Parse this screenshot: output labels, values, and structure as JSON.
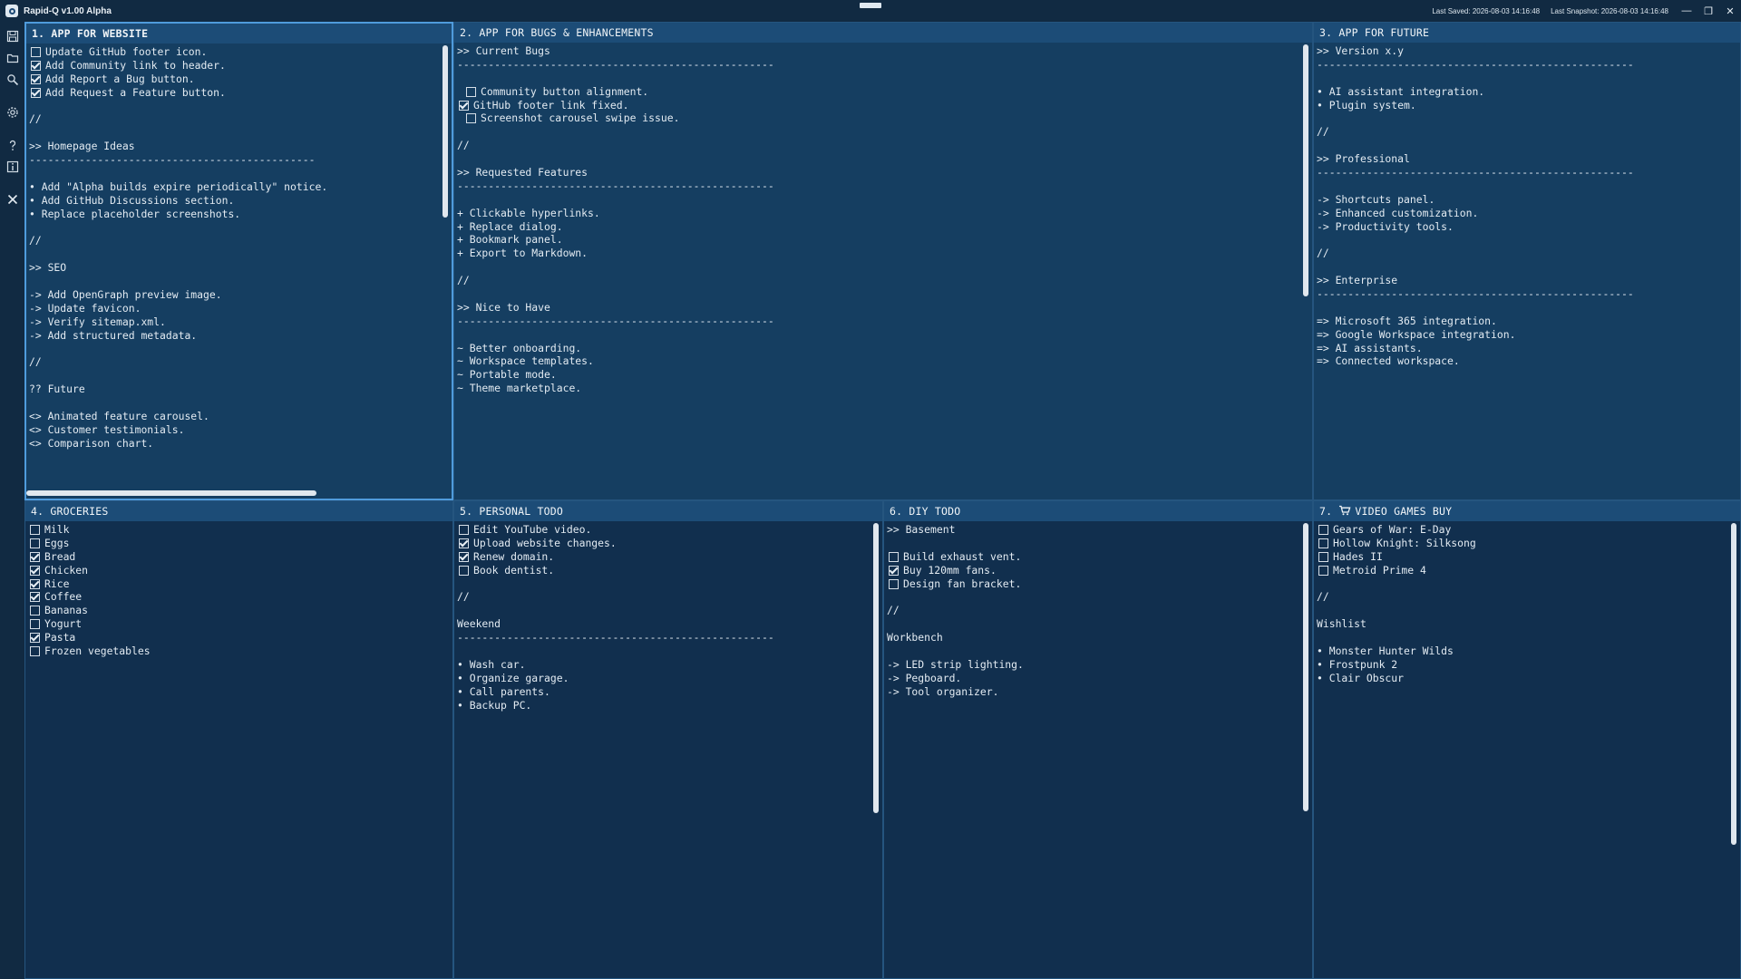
{
  "app": {
    "title": "Rapid-Q v1.00 Alpha",
    "last_saved": "Last Saved: 2026-08-03 14:16:48",
    "last_snapshot": "Last Snapshot: 2026-08-03 14:16:48",
    "minimize": "—",
    "restore": "❐",
    "close": "✕"
  },
  "sidebar": {
    "icons": [
      "save-icon",
      "folder-icon",
      "search-icon",
      "gear-icon",
      "help-icon",
      "info-icon",
      "close-icon"
    ]
  },
  "panels": [
    {
      "id": "p1",
      "title": "1. APP FOR WEBSITE",
      "lines": [
        {
          "cb": false,
          "text": "Update GitHub footer icon."
        },
        {
          "cb": true,
          "text": "Add Community link to header."
        },
        {
          "cb": true,
          "text": "Add Report a Bug button."
        },
        {
          "cb": true,
          "text": "Add Request a Feature button."
        },
        {
          "text": ""
        },
        {
          "text": "//"
        },
        {
          "text": ""
        },
        {
          "text": ">> Homepage Ideas"
        },
        {
          "text": "----------------------------------------------"
        },
        {
          "text": ""
        },
        {
          "text": "• Add \"Alpha builds expire periodically\" notice."
        },
        {
          "text": "• Add GitHub Discussions section."
        },
        {
          "text": "• Replace placeholder screenshots."
        },
        {
          "text": ""
        },
        {
          "text": "//"
        },
        {
          "text": ""
        },
        {
          "text": ">> SEO"
        },
        {
          "text": ""
        },
        {
          "text": "-> Add OpenGraph preview image."
        },
        {
          "text": "-> Update favicon."
        },
        {
          "text": "-> Verify sitemap.xml."
        },
        {
          "text": "-> Add structured metadata."
        },
        {
          "text": ""
        },
        {
          "text": "//"
        },
        {
          "text": ""
        },
        {
          "text": "?? Future"
        },
        {
          "text": ""
        },
        {
          "text": "<> Animated feature carousel."
        },
        {
          "text": "<> Customer testimonials."
        },
        {
          "text": "<> Comparison chart."
        }
      ]
    },
    {
      "id": "p2",
      "title": "2. APP FOR BUGS & ENHANCEMENTS",
      "lines": [
        {
          "text": ">> Current Bugs"
        },
        {
          "text": "---------------------------------------------------"
        },
        {
          "text": ""
        },
        {
          "cb": false,
          "indent": true,
          "text": "Community button alignment."
        },
        {
          "cb": true,
          "text": "GitHub footer link fixed."
        },
        {
          "cb": false,
          "indent": true,
          "text": "Screenshot carousel swipe issue."
        },
        {
          "text": ""
        },
        {
          "text": "//"
        },
        {
          "text": ""
        },
        {
          "text": ">> Requested Features"
        },
        {
          "text": "---------------------------------------------------"
        },
        {
          "text": ""
        },
        {
          "text": "+ Clickable hyperlinks."
        },
        {
          "text": "+ Replace dialog."
        },
        {
          "text": "+ Bookmark panel."
        },
        {
          "text": "+ Export to Markdown."
        },
        {
          "text": ""
        },
        {
          "text": "//"
        },
        {
          "text": ""
        },
        {
          "text": ">> Nice to Have"
        },
        {
          "text": "---------------------------------------------------"
        },
        {
          "text": ""
        },
        {
          "text": "~ Better onboarding."
        },
        {
          "text": "~ Workspace templates."
        },
        {
          "text": "~ Portable mode."
        },
        {
          "text": "~ Theme marketplace."
        }
      ]
    },
    {
      "id": "p3",
      "title": "3. APP FOR FUTURE",
      "lines": [
        {
          "text": ">> Version x.y"
        },
        {
          "text": "---------------------------------------------------"
        },
        {
          "text": ""
        },
        {
          "text": "• AI assistant integration."
        },
        {
          "text": "• Plugin system."
        },
        {
          "text": ""
        },
        {
          "text": "//"
        },
        {
          "text": ""
        },
        {
          "text": ">> Professional"
        },
        {
          "text": "---------------------------------------------------"
        },
        {
          "text": ""
        },
        {
          "text": "-> Shortcuts panel."
        },
        {
          "text": "-> Enhanced customization."
        },
        {
          "text": "-> Productivity tools."
        },
        {
          "text": ""
        },
        {
          "text": "//"
        },
        {
          "text": ""
        },
        {
          "text": ">> Enterprise"
        },
        {
          "text": "---------------------------------------------------"
        },
        {
          "text": ""
        },
        {
          "text": "=> Microsoft 365 integration."
        },
        {
          "text": "=> Google Workspace integration."
        },
        {
          "text": "=> AI assistants."
        },
        {
          "text": "=> Connected workspace."
        }
      ]
    },
    {
      "id": "p4",
      "title": "4. GROCERIES",
      "lines": [
        {
          "cb": false,
          "text": "Milk"
        },
        {
          "cb": false,
          "text": "Eggs"
        },
        {
          "cb": true,
          "text": "Bread"
        },
        {
          "cb": true,
          "text": "Chicken"
        },
        {
          "cb": true,
          "text": "Rice"
        },
        {
          "cb": true,
          "text": "Coffee"
        },
        {
          "cb": false,
          "text": "Bananas"
        },
        {
          "cb": false,
          "text": "Yogurt"
        },
        {
          "cb": true,
          "text": "Pasta"
        },
        {
          "cb": false,
          "text": "Frozen vegetables"
        }
      ]
    },
    {
      "id": "p5",
      "title": "5. PERSONAL TODO",
      "lines": [
        {
          "cb": false,
          "text": "Edit YouTube video."
        },
        {
          "cb": true,
          "text": "Upload website changes."
        },
        {
          "cb": true,
          "text": "Renew domain."
        },
        {
          "cb": false,
          "text": "Book dentist."
        },
        {
          "text": ""
        },
        {
          "text": "//"
        },
        {
          "text": ""
        },
        {
          "text": "Weekend"
        },
        {
          "text": "---------------------------------------------------"
        },
        {
          "text": ""
        },
        {
          "text": "• Wash car."
        },
        {
          "text": "• Organize garage."
        },
        {
          "text": "• Call parents."
        },
        {
          "text": "• Backup PC."
        }
      ]
    },
    {
      "id": "p6",
      "title": "6. DIY TODO",
      "lines": [
        {
          "text": ">> Basement"
        },
        {
          "text": ""
        },
        {
          "cb": false,
          "text": "Build exhaust vent."
        },
        {
          "cb": true,
          "text": "Buy 120mm fans."
        },
        {
          "cb": false,
          "text": "Design fan bracket."
        },
        {
          "text": ""
        },
        {
          "text": "//"
        },
        {
          "text": ""
        },
        {
          "text": "Workbench"
        },
        {
          "text": ""
        },
        {
          "text": "-> LED strip lighting."
        },
        {
          "text": "-> Pegboard."
        },
        {
          "text": "-> Tool organizer."
        }
      ]
    },
    {
      "id": "p7",
      "title": "7.",
      "title_rest": "VIDEO GAMES BUY",
      "lines": [
        {
          "cb": false,
          "text": "Gears of War: E-Day"
        },
        {
          "cb": false,
          "text": "Hollow Knight: Silksong"
        },
        {
          "cb": false,
          "text": "Hades II"
        },
        {
          "cb": false,
          "text": "Metroid Prime 4"
        },
        {
          "text": ""
        },
        {
          "text": "//"
        },
        {
          "text": ""
        },
        {
          "text": "Wishlist"
        },
        {
          "text": ""
        },
        {
          "text": "• Monster Hunter Wilds"
        },
        {
          "text": "• Frostpunk 2"
        },
        {
          "text": "• Clair Obscur"
        }
      ]
    }
  ]
}
